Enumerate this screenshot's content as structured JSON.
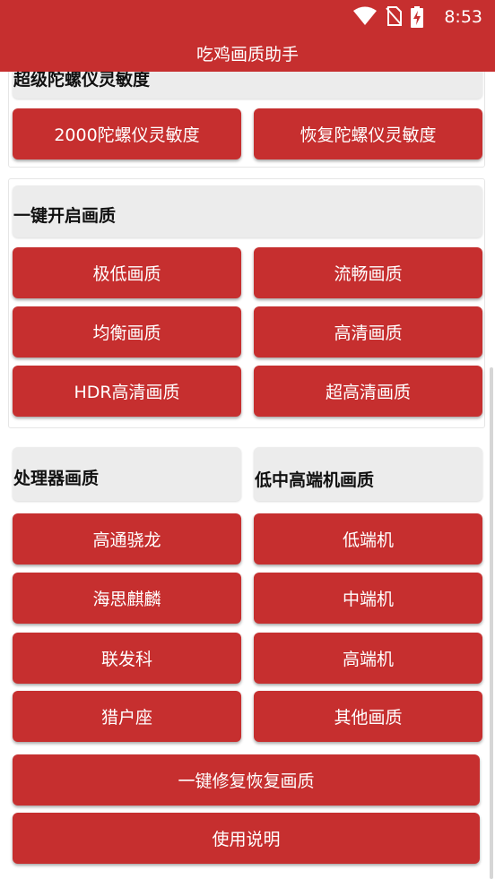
{
  "status": {
    "time": "8:53"
  },
  "app_title": "吃鸡画质助手",
  "gyro": {
    "header": "超级陀螺仪灵敏度",
    "buttons": [
      "2000陀螺仪灵敏度",
      "恢复陀螺仪灵敏度"
    ]
  },
  "one_key_quality": {
    "header": "一键开启画质",
    "buttons": [
      "极低画质",
      "流畅画质",
      "均衡画质",
      "高清画质",
      "HDR高清画质",
      "超高清画质"
    ]
  },
  "processor_quality": {
    "header": "处理器画质",
    "buttons": [
      "高通骁龙",
      "海思麒麟",
      "联发科",
      "猎户座"
    ]
  },
  "tier_quality": {
    "header": "低中高端机画质",
    "buttons": [
      "低端机",
      "中端机",
      "高端机",
      "其他画质"
    ]
  },
  "bottom_buttons": {
    "restore": "一键修复恢复画质",
    "help": "使用说明"
  },
  "colors": {
    "primary": "#c62f2f",
    "header_bg": "#ececec"
  },
  "icons": [
    "wifi-icon",
    "no-sim-icon",
    "battery-charging-icon"
  ]
}
